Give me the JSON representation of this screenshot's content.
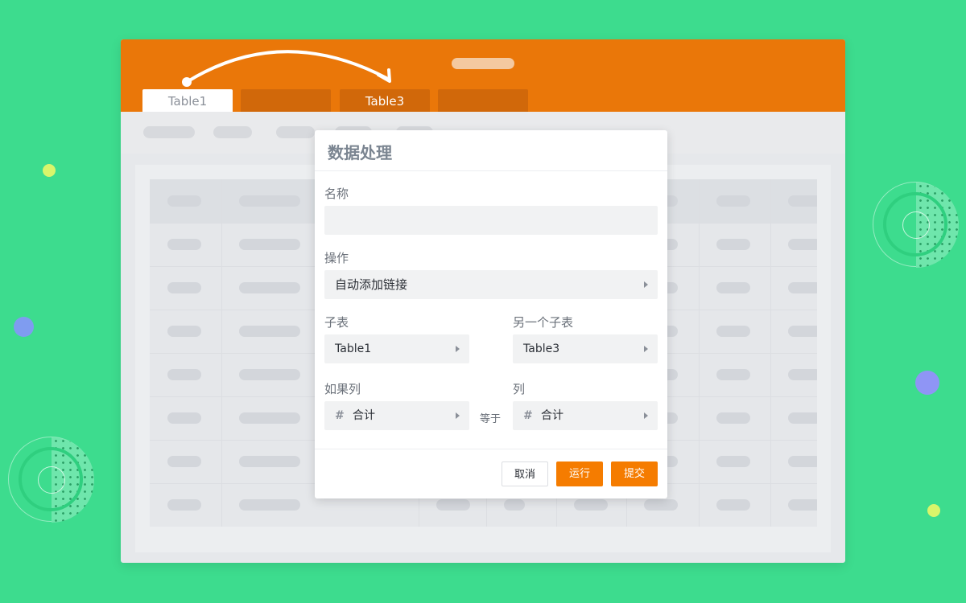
{
  "colors": {
    "background": "#3ddc8e",
    "brand": "#ea7709",
    "button_primary": "#f57c00"
  },
  "header": {
    "tabs": [
      {
        "label": "Table1",
        "active": true
      },
      {
        "label": "",
        "active": false
      },
      {
        "label": "Table3",
        "active": false
      },
      {
        "label": "",
        "active": false
      }
    ]
  },
  "modal": {
    "title": "数据处理",
    "name_label": "名称",
    "name_value": "",
    "operation_label": "操作",
    "operation_value": "自动添加链接",
    "child_table_label": "子表",
    "child_table_value": "Table1",
    "other_child_table_label": "另一个子表",
    "other_child_table_value": "Table3",
    "if_column_label": "如果列",
    "if_column_value": "合计",
    "equals_label": "等于",
    "column_label": "列",
    "column_value": "合计",
    "cancel_label": "取消",
    "run_label": "运行",
    "submit_label": "提交"
  }
}
